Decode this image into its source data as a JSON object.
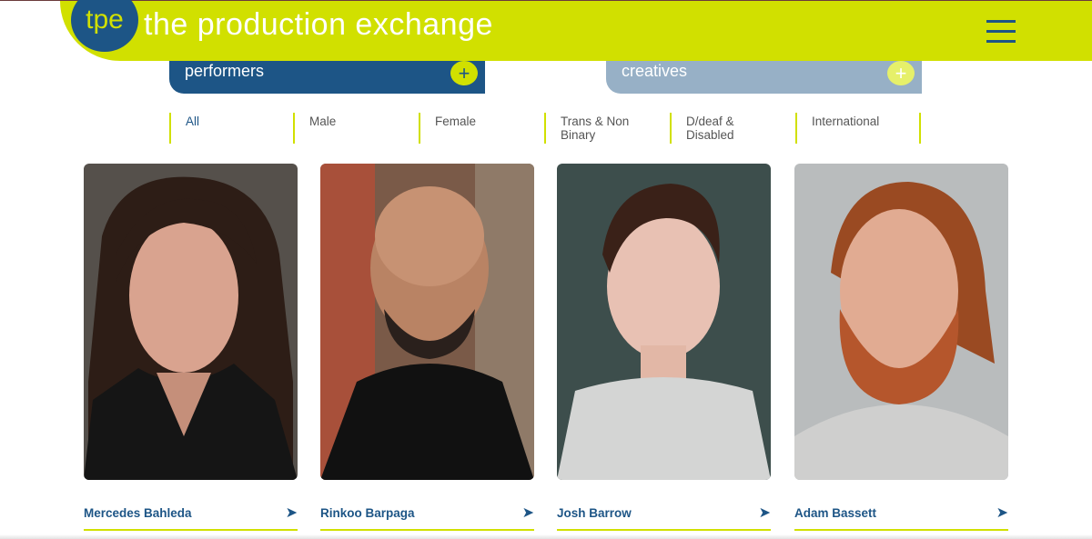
{
  "brand": {
    "logo_text": "tpe",
    "title": "the production exchange",
    "accent_color": "#d1e000",
    "primary_color": "#1d5586"
  },
  "menu": {
    "icon": "hamburger-menu-icon"
  },
  "categories": [
    {
      "label": "performers",
      "icon": "plus-icon",
      "active": true
    },
    {
      "label": "creatives",
      "icon": "plus-icon",
      "active": false
    }
  ],
  "filters": [
    {
      "label": "All",
      "active": true
    },
    {
      "label": "Male",
      "active": false
    },
    {
      "label": "Female",
      "active": false
    },
    {
      "label": "Trans & Non Binary",
      "active": false
    },
    {
      "label": "D/deaf & Disabled",
      "active": false
    },
    {
      "label": "International",
      "active": false
    }
  ],
  "people": [
    {
      "name": "Mercedes Bahleda",
      "icon": "arrow-right-icon"
    },
    {
      "name": "Rinkoo Barpaga",
      "icon": "arrow-right-icon"
    },
    {
      "name": "Josh Barrow",
      "icon": "arrow-right-icon"
    },
    {
      "name": "Adam Bassett",
      "icon": "arrow-right-icon"
    }
  ],
  "symbols": {
    "plus": "+",
    "arrow": "➤"
  }
}
